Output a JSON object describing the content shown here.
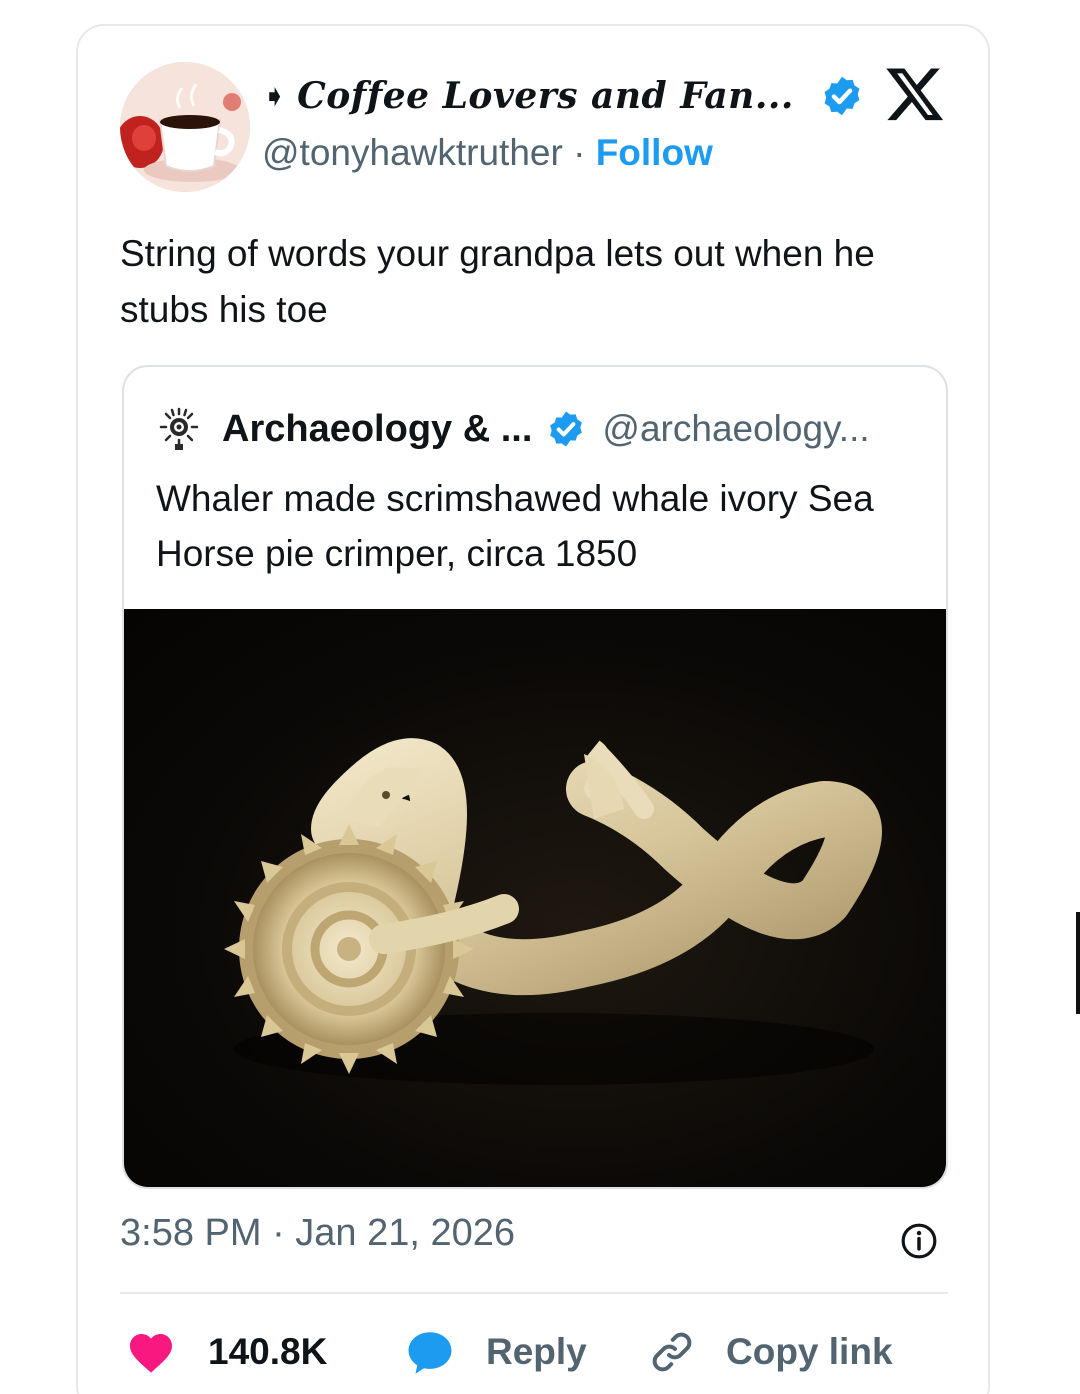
{
  "post": {
    "author": {
      "name_glyph": "➧",
      "display_name": "Coffee Lovers and Fan...",
      "handle": "@tonyhawktruther",
      "separator": "·",
      "follow_label": "Follow",
      "avatar_icon": "coffee-cup-avatar",
      "verified_icon": "verified-badge-icon"
    },
    "platform_icon": "x-logo",
    "text": "String of words your grandpa lets out when he stubs his toe",
    "quote": {
      "icon": "archaeology-logo-icon",
      "name": "Archaeology & ...",
      "handle": "@archaeology...",
      "text": "Whaler made scrimshawed whale ivory Sea Horse pie crimper, circa 1850",
      "image": "ivory-sea-horse-pie-crimper-photo"
    },
    "timestamp": "3:58 PM · Jan 21, 2026",
    "info_icon": "info-icon",
    "actions": {
      "like_count": "140.8K",
      "reply_label": "Reply",
      "copy_label": "Copy link"
    }
  },
  "colors": {
    "accent": "#1d9bf0",
    "text": "#0f1419",
    "secondary": "#536471",
    "like": "#f91880",
    "border": "#e6e8eb"
  }
}
